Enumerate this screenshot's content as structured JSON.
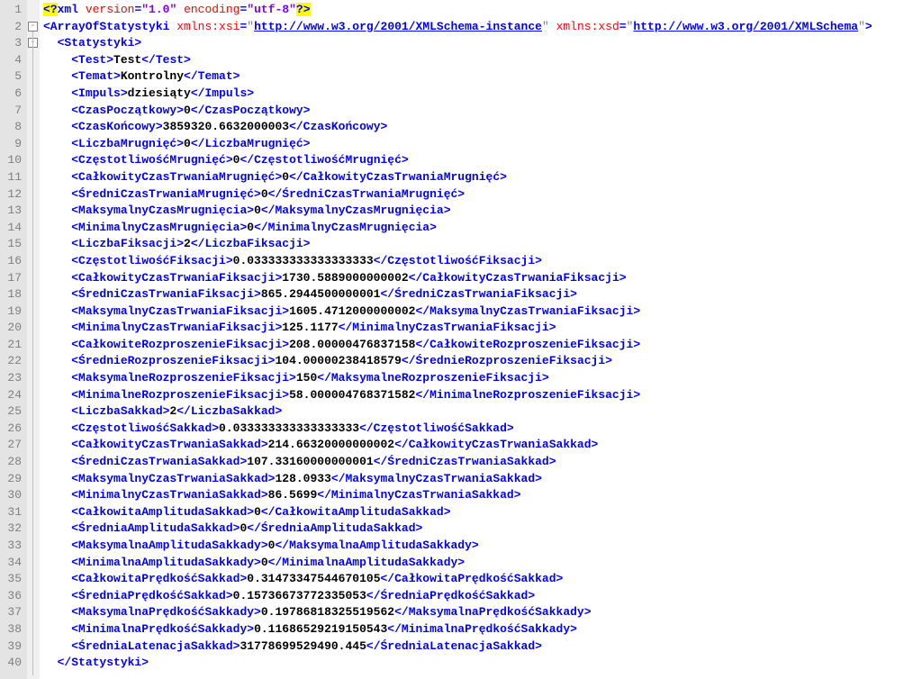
{
  "lineCount": 40,
  "xmlDecl": {
    "open": "<?",
    "name": "xml",
    "attrs": [
      {
        "n": "version",
        "v": "\"1.0\""
      },
      {
        "n": "encoding",
        "v": "\"utf-8\""
      }
    ],
    "close": "?>"
  },
  "root": {
    "name": "ArrayOfStatystyki",
    "attrs": [
      {
        "n": "xmlns:xsi",
        "link": "http://www.w3.org/2001/XMLSchema-instance"
      },
      {
        "n": "xmlns:xsd",
        "link": "http://www.w3.org/2001/XMLSchema"
      }
    ]
  },
  "statOpen": "Statystyki",
  "statClose": "Statystyki",
  "elements": [
    {
      "tag": "Test",
      "val": "Test"
    },
    {
      "tag": "Temat",
      "val": "Kontrolny"
    },
    {
      "tag": "Impuls",
      "val": "dziesiąty"
    },
    {
      "tag": "CzasPoczątkowy",
      "val": "0"
    },
    {
      "tag": "CzasKońcowy",
      "val": "3859320.6632000003"
    },
    {
      "tag": "LiczbaMrugnięć",
      "val": "0"
    },
    {
      "tag": "CzęstotliwośćMrugnięć",
      "val": "0"
    },
    {
      "tag": "CałkowityCzasTrwaniaMrugnięć",
      "val": "0"
    },
    {
      "tag": "ŚredniCzasTrwaniaMrugnięć",
      "val": "0"
    },
    {
      "tag": "MaksymalnyCzasMrugnięcia",
      "val": "0"
    },
    {
      "tag": "MinimalnyCzasMrugnięcia",
      "val": "0"
    },
    {
      "tag": "LiczbaFiksacji",
      "val": "2"
    },
    {
      "tag": "CzęstotliwośćFiksacji",
      "val": "0.033333333333333333"
    },
    {
      "tag": "CałkowityCzasTrwaniaFiksacji",
      "val": "1730.5889000000002"
    },
    {
      "tag": "ŚredniCzasTrwaniaFiksacji",
      "val": "865.2944500000001"
    },
    {
      "tag": "MaksymalnyCzasTrwaniaFiksacji",
      "val": "1605.4712000000002"
    },
    {
      "tag": "MinimalnyCzasTrwaniaFiksacji",
      "val": "125.1177"
    },
    {
      "tag": "CałkowiteRozproszenieFiksacji",
      "val": "208.00000476837158"
    },
    {
      "tag": "ŚrednieRozproszenieFiksacji",
      "val": "104.00000238418579"
    },
    {
      "tag": "MaksymalneRozproszenieFiksacji",
      "val": "150"
    },
    {
      "tag": "MinimalneRozproszenieFiksacji",
      "val": "58.000004768371582"
    },
    {
      "tag": "LiczbaSakkad",
      "val": "2"
    },
    {
      "tag": "CzęstotliwośćSakkad",
      "val": "0.033333333333333333"
    },
    {
      "tag": "CałkowityCzasTrwaniaSakkad",
      "val": "214.66320000000002"
    },
    {
      "tag": "ŚredniCzasTrwaniaSakkad",
      "val": "107.33160000000001"
    },
    {
      "tag": "MaksymalnyCzasTrwaniaSakkad",
      "val": "128.0933"
    },
    {
      "tag": "MinimalnyCzasTrwaniaSakkad",
      "val": "86.5699"
    },
    {
      "tag": "CałkowitaAmplitudaSakkad",
      "val": "0"
    },
    {
      "tag": "ŚredniaAmplitudaSakkad",
      "val": "0"
    },
    {
      "tag": "MaksymalnaAmplitudaSakkady",
      "val": "0"
    },
    {
      "tag": "MinimalnaAmplitudaSakkady",
      "val": "0"
    },
    {
      "tag": "CałkowitaPrędkośćSakkad",
      "val": "0.31473347544670105"
    },
    {
      "tag": "ŚredniaPrędkośćSakkad",
      "val": "0.15736673772335053"
    },
    {
      "tag": "MaksymalnaPrędkośćSakkady",
      "val": "0.19786818325519562"
    },
    {
      "tag": "MinimalnaPrędkośćSakkady",
      "val": "0.11686529219150543"
    },
    {
      "tag": "ŚredniaLatenacjaSakkad",
      "val": "31778699529490.445"
    }
  ]
}
